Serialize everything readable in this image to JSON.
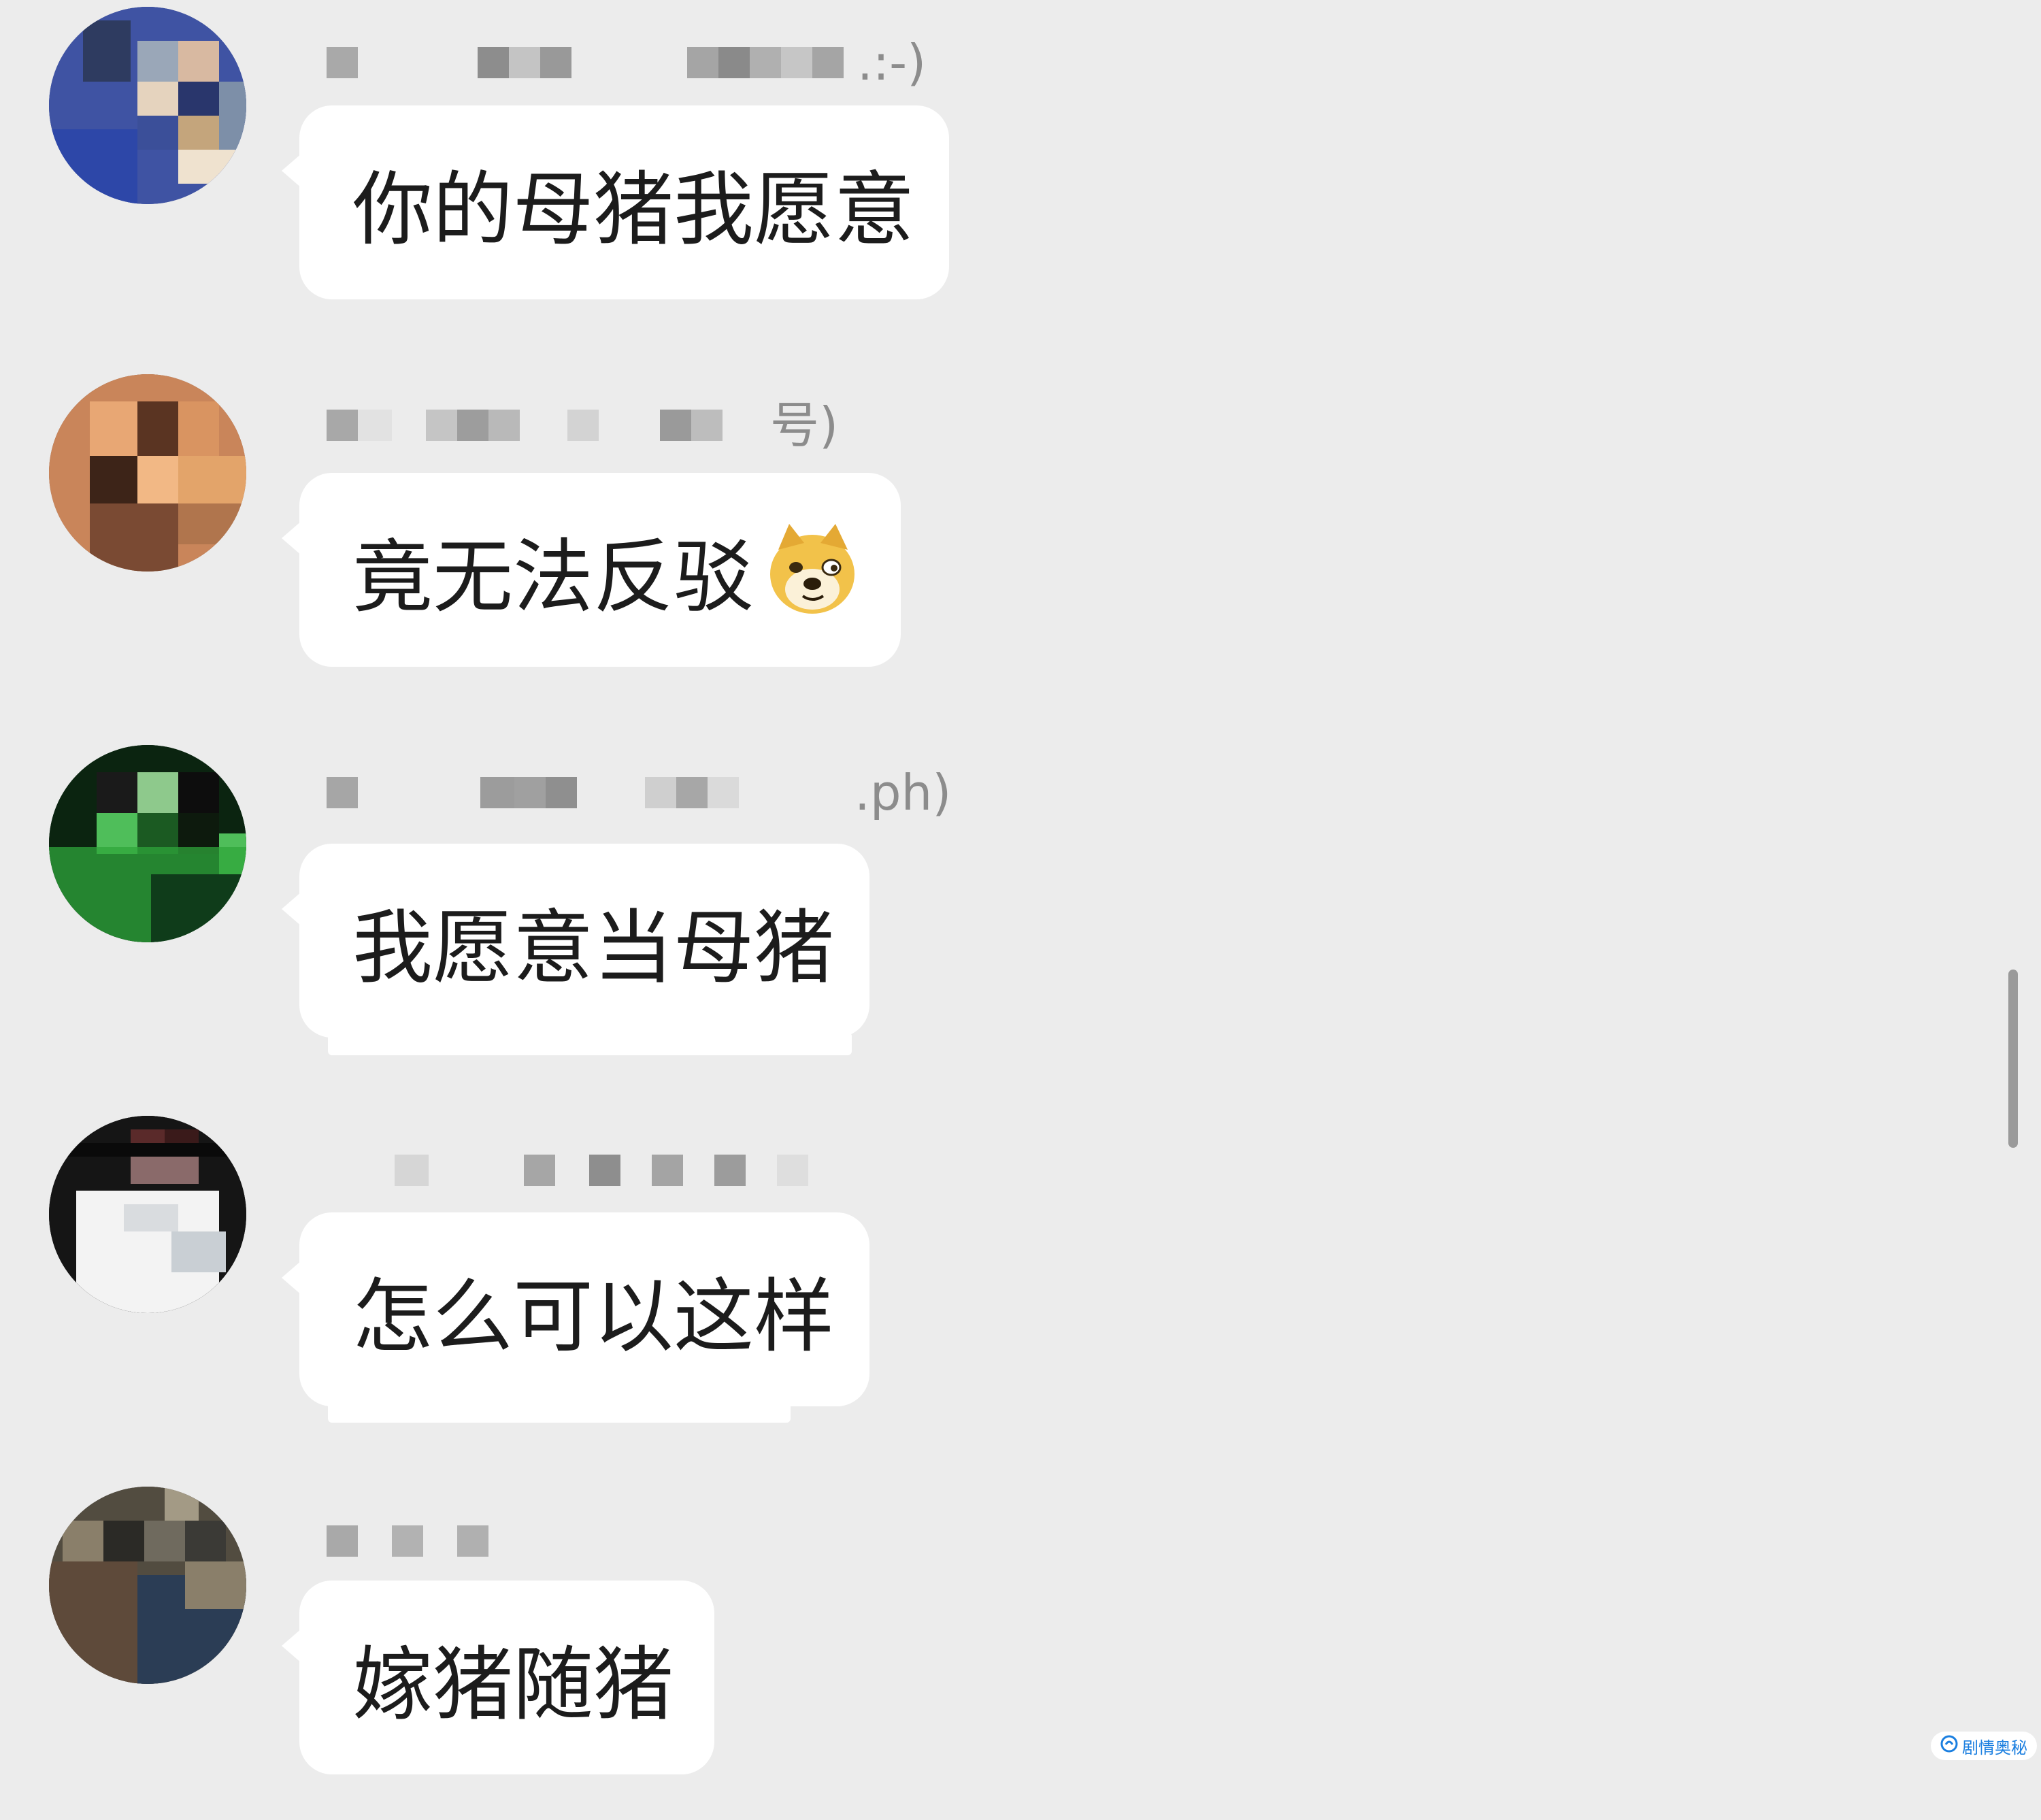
{
  "messages": [
    {
      "sender_suffix": ".:-)",
      "text": "你的母猪我愿意",
      "avatar_colors": [
        "#2a3f8a",
        "#e8d6c2",
        "#7d8fa8",
        "#c4a57c",
        "#32406b",
        "#a0b5d6"
      ]
    },
    {
      "sender_suffix": "号)",
      "text": "竟无法反驳",
      "emoji": "doge-emoji",
      "avatar_colors": [
        "#c9855a",
        "#e3a46a",
        "#3d2418",
        "#b0754d",
        "#f2b885",
        "#7a4a33"
      ]
    },
    {
      "sender_suffix": ".ph)",
      "text": "我愿意当母猪",
      "avatar_colors": [
        "#0f3c1a",
        "#2fa63b",
        "#4fbe5a",
        "#1b5a22",
        "#8ec98c",
        "#0b2410"
      ]
    },
    {
      "sender_suffix": "",
      "text": "怎么可以这样",
      "avatar_colors": [
        "#111111",
        "#f3f3f3",
        "#5a2a2a",
        "#d9dcdf",
        "#2a2a2a",
        "#c9cfd4"
      ]
    },
    {
      "sender_suffix": "",
      "text": "嫁猪随猪",
      "avatar_colors": [
        "#3b3a36",
        "#6f6a5e",
        "#a39a85",
        "#2b3d55",
        "#8a7f6a",
        "#524c40"
      ]
    }
  ],
  "watermark": {
    "text": "剧情奥秘"
  }
}
